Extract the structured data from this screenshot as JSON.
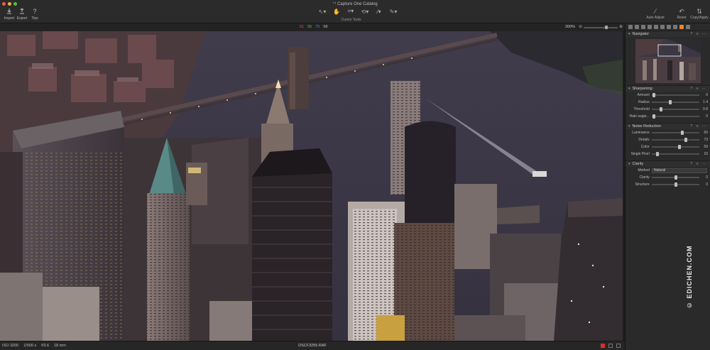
{
  "window": {
    "title": "Capture One Catalog"
  },
  "toolbar": {
    "import_label": "Import",
    "export_label": "Export",
    "tips_label": "Tips",
    "cursor_tools_label": "Cursor Tools",
    "auto_adjust_label": "Auto Adjust",
    "reset_label": "Reset",
    "copy_apply_label": "Copy/Apply"
  },
  "viewer": {
    "rgb": [
      "61",
      "55",
      "75",
      "58"
    ],
    "zoom": "200%"
  },
  "status": {
    "iso": "ISO 3200",
    "shutter": "1/500 s",
    "aperture": "f/3.6",
    "focal": "18 mm",
    "filename": "DSCF3255.RAF"
  },
  "panel": {
    "navigator": {
      "title": "Navigator"
    },
    "sharpening": {
      "title": "Sharpening",
      "rows": [
        {
          "label": "Amount",
          "value": "0",
          "pos": 0.02
        },
        {
          "label": "Radius",
          "value": "1.4",
          "pos": 0.38
        },
        {
          "label": "Threshold",
          "value": "0.8",
          "pos": 0.18
        },
        {
          "label": "Halo suppr...",
          "value": "0",
          "pos": 0.02
        }
      ]
    },
    "noise": {
      "title": "Noise Reduction",
      "rows": [
        {
          "label": "Luminance",
          "value": "65",
          "pos": 0.65
        },
        {
          "label": "Details",
          "value": "73",
          "pos": 0.73
        },
        {
          "label": "Color",
          "value": "59",
          "pos": 0.59
        },
        {
          "label": "Single Pixel",
          "value": "10",
          "pos": 0.1
        }
      ]
    },
    "clarity": {
      "title": "Clarity",
      "method_label": "Method",
      "method_value": "Natural",
      "rows": [
        {
          "label": "Clarity",
          "value": "0",
          "pos": 0.5
        },
        {
          "label": "Structure",
          "value": "0",
          "pos": 0.5
        }
      ]
    }
  },
  "watermark": "© EDICHEN.COM",
  "colors": {
    "accent": "#e8862c",
    "red": "#e04a4a",
    "green": "#4ec25a",
    "blue": "#4a8ce0",
    "gray": "#bdbdbd"
  }
}
